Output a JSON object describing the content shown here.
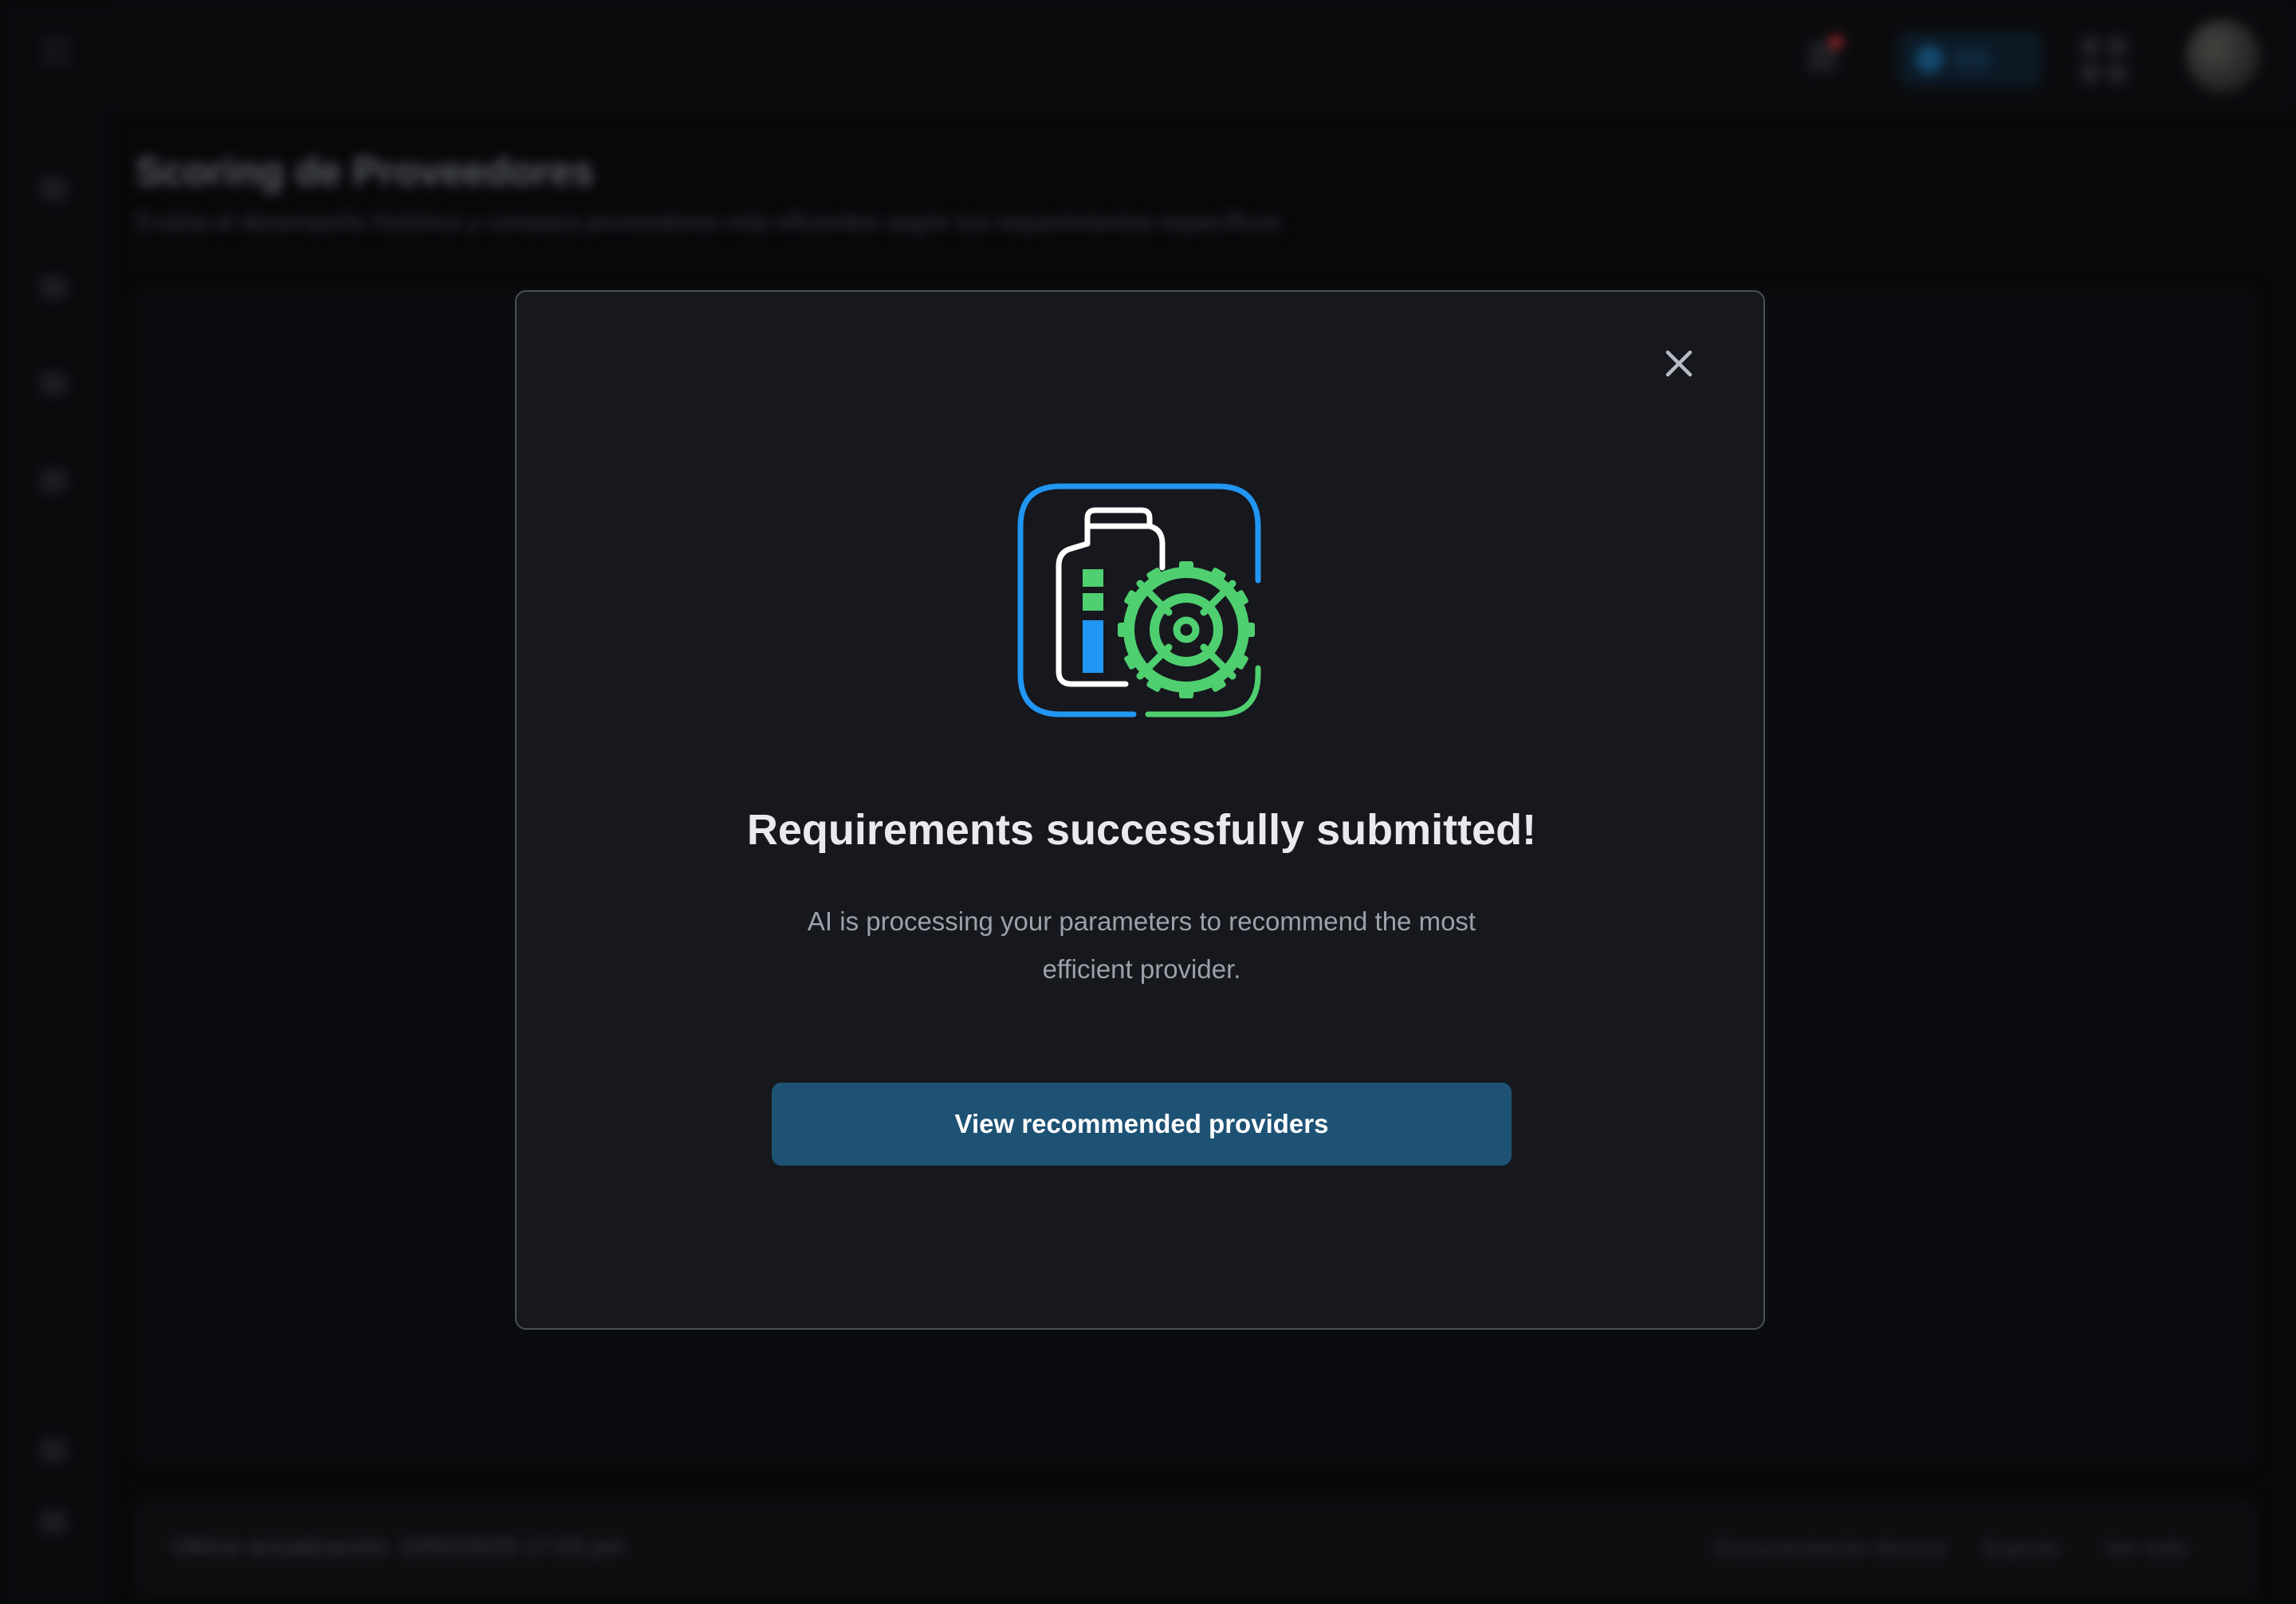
{
  "background": {
    "page_title": "Scoring de Proveedores",
    "page_subtitle": "Evalúa el desempeño histórico y compara proveedores más eficientes según tus requerimientos específicos.",
    "language_label": "ES",
    "footer": {
      "last_update": "Última actualización: 10/02/2025 17:03 pm",
      "links": [
        "Documentación técnica",
        "Soporte",
        "Ver todo"
      ]
    }
  },
  "modal": {
    "title": "Requirements successfully submitted!",
    "message": "AI is processing your parameters to recommend the most efficient provider.",
    "primary_button": "View recommended providers",
    "icon": "clipboard-gear-icon",
    "close_icon": "close-icon"
  },
  "colors": {
    "accent_blue": "#2196f3",
    "accent_green": "#4fcf70",
    "button_bg": "#1d5274",
    "modal_bg": "#16181d",
    "notification_dot": "#d9363e"
  }
}
